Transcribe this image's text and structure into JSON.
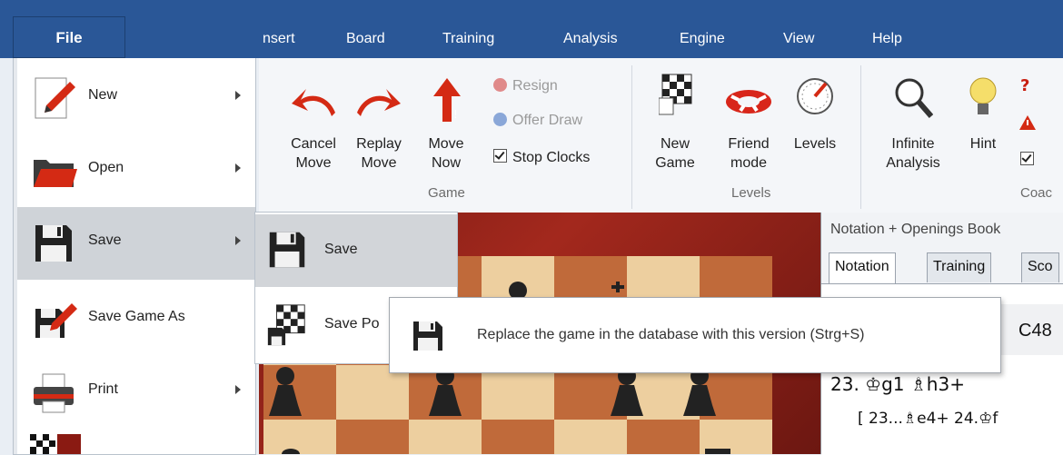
{
  "menubar": {
    "file": "File",
    "items": [
      "nsert",
      "Board",
      "Training",
      "Analysis",
      "Engine",
      "View",
      "Help"
    ]
  },
  "ribbon": {
    "cancel_move": "Cancel Move",
    "replay_move": "Replay Move",
    "move_now": "Move Now",
    "resign": "Resign",
    "offer_draw": "Offer Draw",
    "stop_clocks": "Stop Clocks",
    "game_group": "Game",
    "new_game": "New Game",
    "friend_mode": "Friend mode",
    "levels": "Levels",
    "levels_group": "Levels",
    "infinite_analysis": "Infinite Analysis",
    "hint": "Hint",
    "coach_group": "Coac"
  },
  "file_menu": {
    "items": [
      {
        "label": "New",
        "icon": "new-document-icon",
        "has_submenu": true
      },
      {
        "label": "Open",
        "icon": "folder-open-icon",
        "has_submenu": true
      },
      {
        "label": "Save",
        "icon": "floppy-disk-icon",
        "has_submenu": true
      },
      {
        "label": "Save Game As",
        "icon": "save-as-icon",
        "has_submenu": false
      },
      {
        "label": "Print",
        "icon": "printer-icon",
        "has_submenu": true
      }
    ]
  },
  "save_submenu": {
    "items": [
      {
        "label": "Save",
        "icon": "floppy-disk-icon"
      },
      {
        "label": "Save Po",
        "icon": "save-position-icon"
      }
    ]
  },
  "tooltip": {
    "text": "Replace the game in the database with this version (Strg+S)"
  },
  "notation": {
    "title": "Notation + Openings Book",
    "tabs": [
      "Notation",
      "Training",
      "Sco"
    ],
    "eco": "C48",
    "move_line": "23. ♔g1  ♗h3+",
    "variation": "[ 23...♗e4+  24.♔f"
  },
  "colors": {
    "menubar": "#2a5797",
    "board_light": "#edcf9f",
    "board_dark": "#c06a3a",
    "frame": "#8f2118"
  }
}
